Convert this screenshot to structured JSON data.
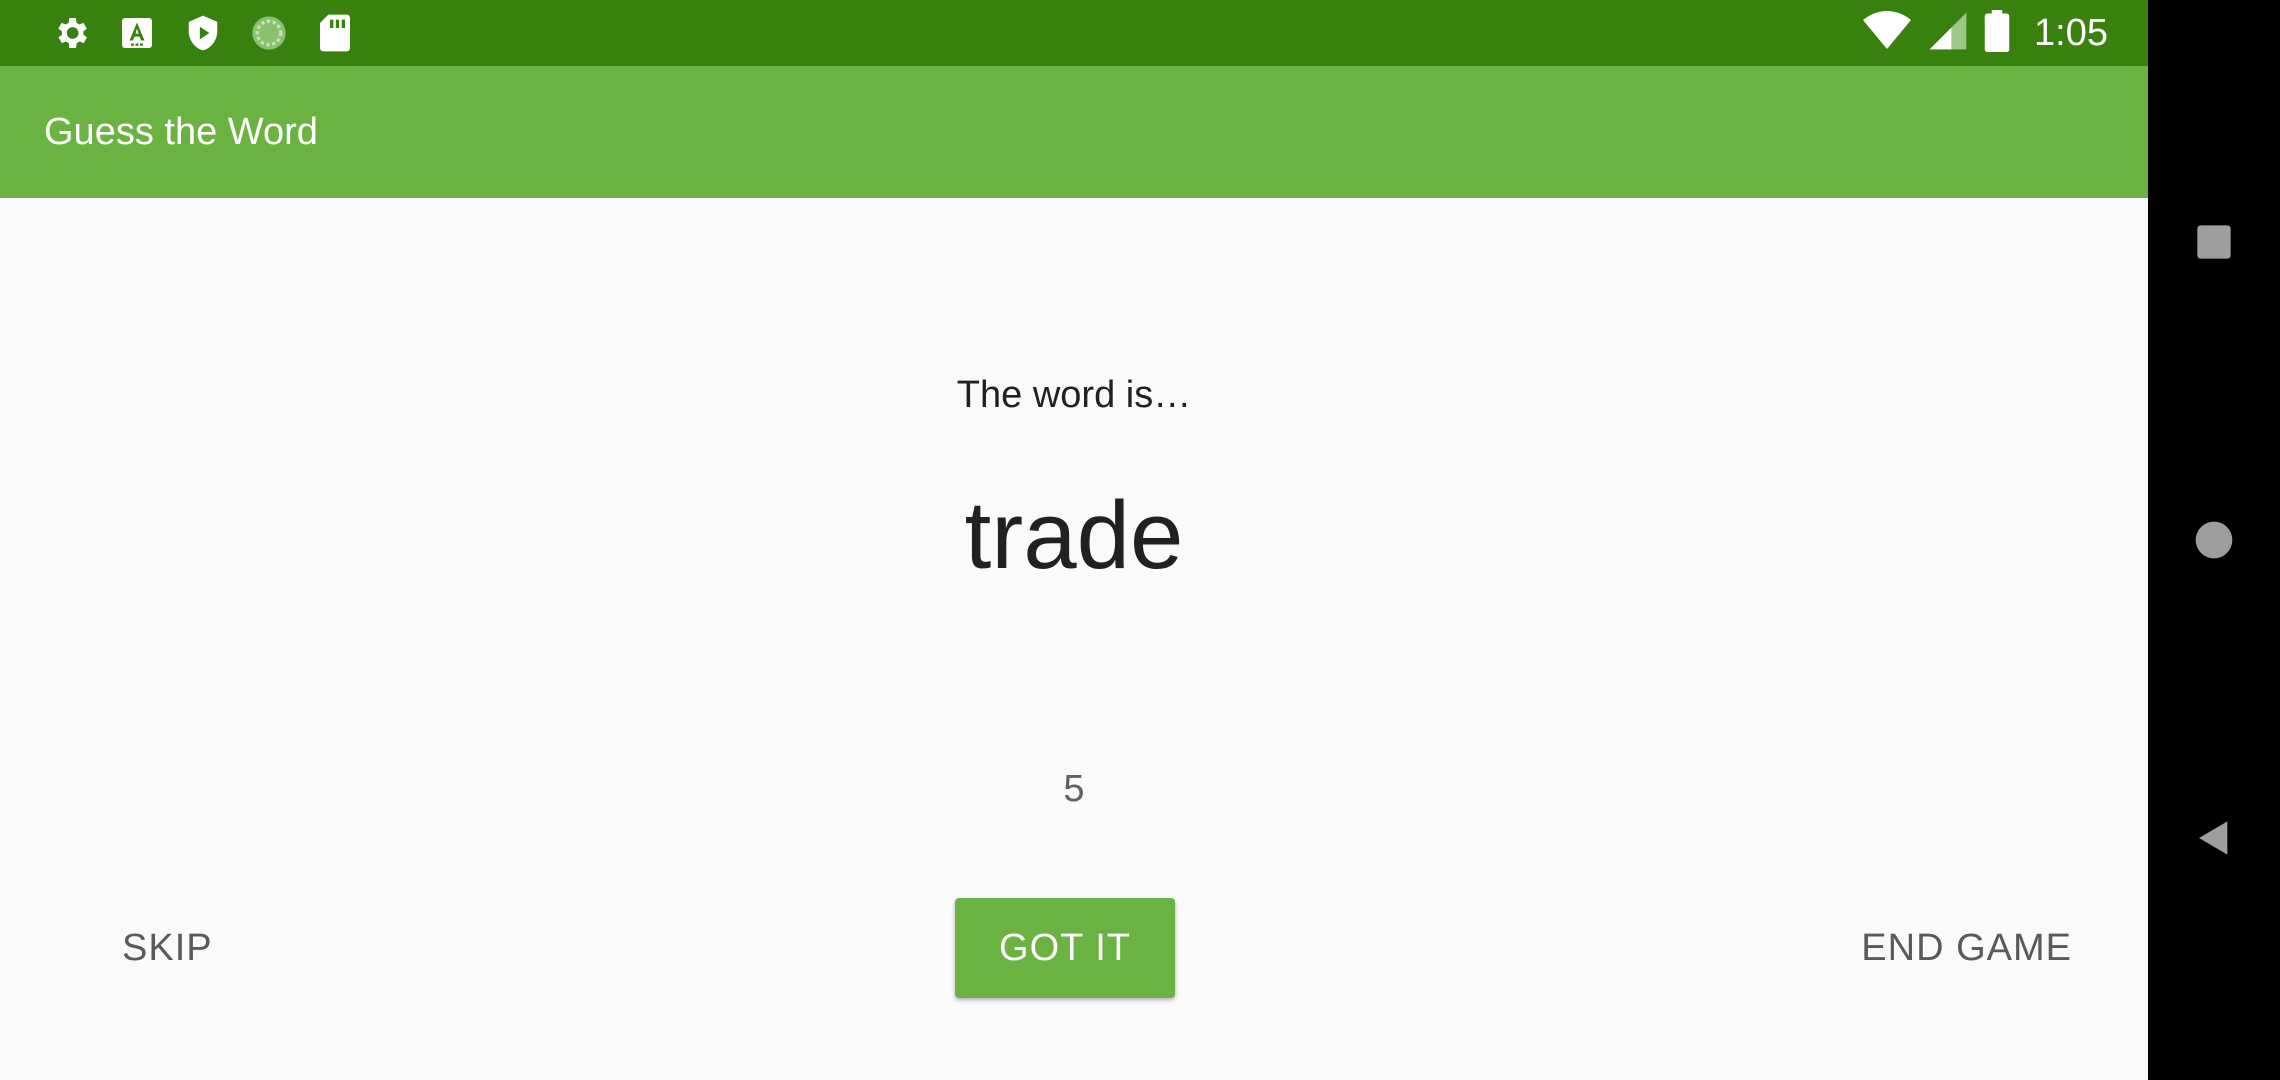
{
  "status_bar": {
    "time": "1:05",
    "left_icons": [
      "gear-icon",
      "font-a-icon",
      "shield-play-icon",
      "sync-circle-icon",
      "sd-card-icon"
    ],
    "right_icons": [
      "wifi-icon",
      "cellular-signal-icon",
      "battery-icon"
    ]
  },
  "app_bar": {
    "title": "Guess the Word"
  },
  "game": {
    "word_label": "The word is…",
    "word": "trade",
    "timer": "5"
  },
  "actions": {
    "skip_label": "SKIP",
    "got_it_label": "GOT IT",
    "end_game_label": "END GAME"
  },
  "nav_bar": {
    "icons": [
      "recents-square-icon",
      "home-circle-icon",
      "back-triangle-icon"
    ]
  },
  "colors": {
    "status_bar": "#38810f",
    "app_bar": "#6ab343",
    "primary_button": "#6ab343",
    "background": "#fafafa"
  }
}
